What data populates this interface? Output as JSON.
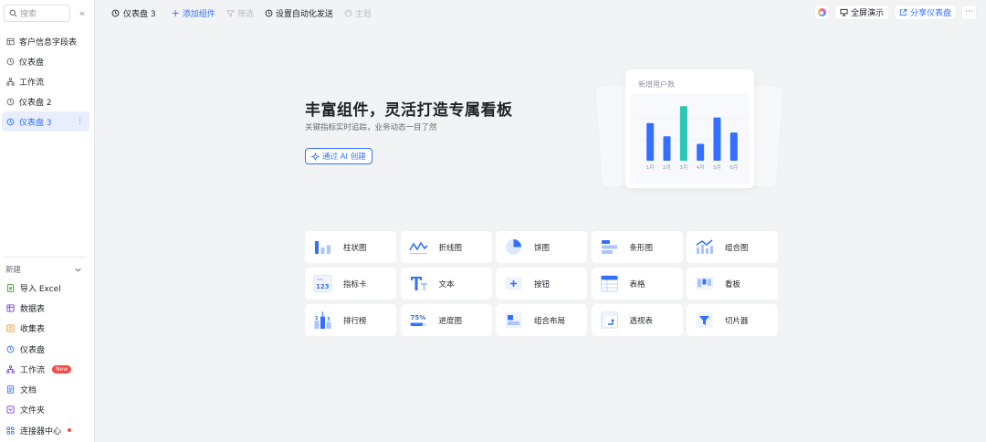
{
  "sidebar": {
    "search_placeholder": "搜索",
    "items": [
      {
        "label": "客户信息字段表",
        "icon": "table-icon"
      },
      {
        "label": "仪表盘",
        "icon": "dashboard-icon"
      },
      {
        "label": "工作流",
        "icon": "workflow-icon"
      },
      {
        "label": "仪表盘 2",
        "icon": "dashboard-icon"
      },
      {
        "label": "仪表盘 3",
        "icon": "dashboard-icon",
        "active": true
      }
    ],
    "new_section_label": "新建",
    "new_items": [
      {
        "label": "导入 Excel",
        "icon": "excel-icon",
        "color": "#2ea121"
      },
      {
        "label": "数据表",
        "icon": "datatable-icon",
        "color": "#7f3bf5"
      },
      {
        "label": "收集表",
        "icon": "form-icon",
        "color": "#ff8800"
      },
      {
        "label": "仪表盘",
        "icon": "dashboard-icon",
        "color": "#3370ff"
      },
      {
        "label": "工作流",
        "icon": "workflow-icon",
        "color": "#7f3bf5",
        "badge": "New"
      },
      {
        "label": "文档",
        "icon": "doc-icon",
        "color": "#3370ff"
      },
      {
        "label": "文件夹",
        "icon": "folder-icon",
        "color": "#7f3bf5"
      },
      {
        "label": "连接器中心",
        "icon": "connector-icon",
        "color": "#3370ff",
        "dot": true
      }
    ]
  },
  "topbar": {
    "title": "仪表盘 3",
    "add_component": "添加组件",
    "filter": "筛选",
    "automation": "设置自动化发送",
    "theme": "主题",
    "fullscreen": "全屏演示",
    "share": "分享仪表盘"
  },
  "hero": {
    "title": "丰富组件，灵活打造专属看板",
    "subtitle": "关键指标实时追踪，业务动态一目了然",
    "ai_button": "通过 AI 创建"
  },
  "chart_data": {
    "type": "bar",
    "title": "新增用户数",
    "categories": [
      "1月",
      "2月",
      "3月",
      "4月",
      "5月",
      "6月"
    ],
    "values": [
      40,
      26,
      58,
      18,
      46,
      30
    ],
    "highlight_index": 2,
    "colors": {
      "bar": "#3370ff",
      "highlight": "#2bc7b5"
    },
    "ylim": [
      0,
      64
    ]
  },
  "components": [
    {
      "label": "柱状图",
      "icon": "bar-chart-icon"
    },
    {
      "label": "折线图",
      "icon": "line-chart-icon"
    },
    {
      "label": "饼图",
      "icon": "pie-chart-icon"
    },
    {
      "label": "条形图",
      "icon": "horizontal-bar-icon"
    },
    {
      "label": "组合图",
      "icon": "combo-chart-icon"
    },
    {
      "label": "指标卡",
      "icon": "metric-card-icon"
    },
    {
      "label": "文本",
      "icon": "text-icon"
    },
    {
      "label": "按钮",
      "icon": "button-icon"
    },
    {
      "label": "表格",
      "icon": "table-icon"
    },
    {
      "label": "看板",
      "icon": "kanban-icon"
    },
    {
      "label": "排行榜",
      "icon": "ranking-icon"
    },
    {
      "label": "进度图",
      "icon": "progress-icon"
    },
    {
      "label": "组合布局",
      "icon": "layout-icon"
    },
    {
      "label": "透视表",
      "icon": "pivot-table-icon"
    },
    {
      "label": "切片器",
      "icon": "slicer-icon"
    }
  ]
}
